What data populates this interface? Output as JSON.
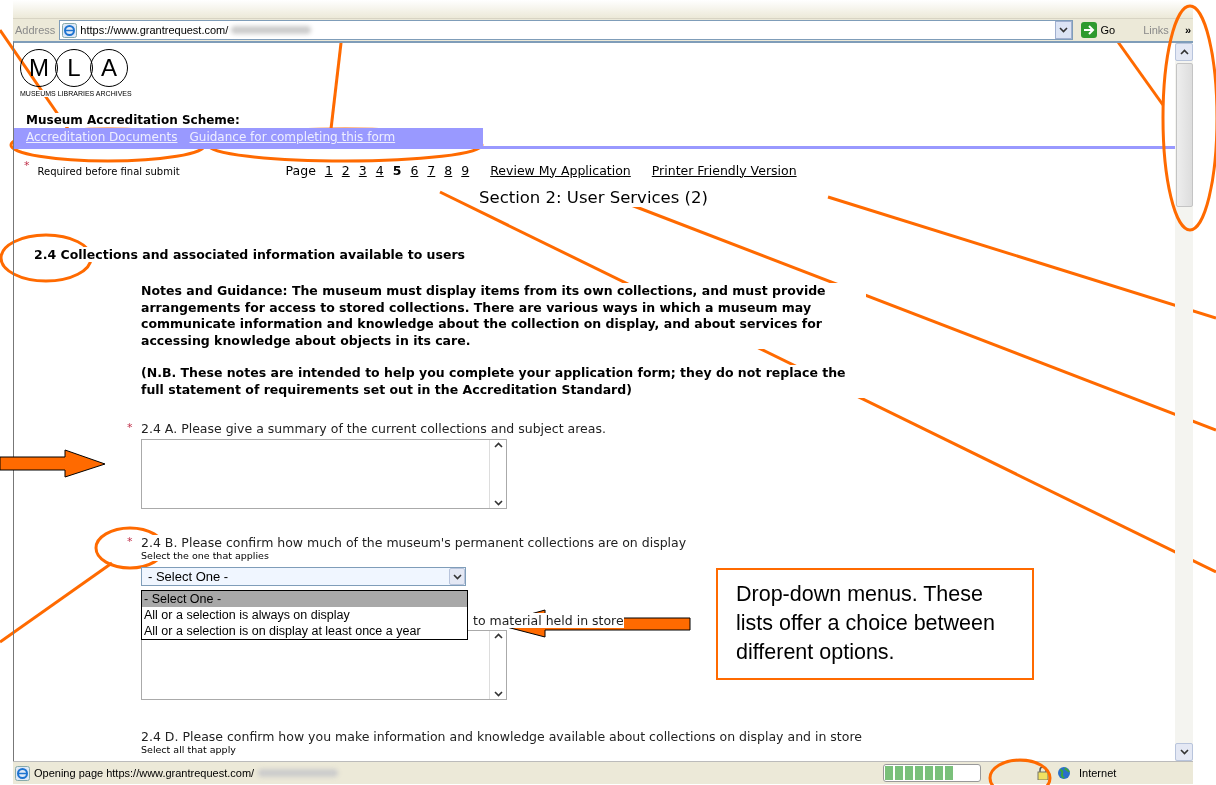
{
  "address_bar": {
    "label": "Address",
    "url": "https://www.grantrequest.com/",
    "go": "Go",
    "links": "Links",
    "more": "»"
  },
  "header": {
    "logo_letters": [
      "M",
      "L",
      "A"
    ],
    "logo_caption": "MUSEUMS LIBRARIES ARCHIVES",
    "scheme_title": "Museum Accreditation Scheme:"
  },
  "nav_links": [
    "Accreditation Documents",
    "Guidance for completing this form"
  ],
  "required_note": {
    "mark": "*",
    "text": "Required before final submit"
  },
  "pagination": {
    "label": "Page",
    "pages": [
      {
        "label": "1",
        "selected": false
      },
      {
        "label": "2",
        "selected": false
      },
      {
        "label": "3",
        "selected": false
      },
      {
        "label": "4",
        "selected": false
      },
      {
        "label": "5",
        "selected": true
      },
      {
        "label": "6",
        "selected": false
      },
      {
        "label": "7",
        "selected": false
      },
      {
        "label": "8",
        "selected": false
      },
      {
        "label": "9",
        "selected": false
      }
    ],
    "links": [
      "Review My Application",
      "Printer Friendly Version"
    ]
  },
  "section_title": "Section 2: User Services (2)",
  "subsection_title": "2.4 Collections and associated information available to users",
  "guidance": [
    "Notes and Guidance: The museum must display items from its own collections, and must provide arrangements for access to stored collections. There are various ways in which a museum may communicate information and knowledge about the collection on display, and about services for accessing knowledge about objects in its care.",
    "(N.B. These notes are intended to help you complete your application form; they do not replace the full statement of requirements set out in the Accreditation Standard)"
  ],
  "questions": [
    {
      "kind": "textarea",
      "required": true,
      "label": "2.4 A. Please give a summary of the current collections and subject areas."
    },
    {
      "kind": "select",
      "required": true,
      "label": "2.4 B. Please confirm how much of the museum's permanent collections are on display",
      "hint": "Select the one that applies",
      "value": "- Select One -",
      "expanded": true,
      "options": [
        {
          "label": "- Select One -",
          "selected": true
        },
        {
          "label": "All or a selection is always on display",
          "selected": false
        },
        {
          "label": "All or a selection is on display at least once a year",
          "selected": false
        }
      ]
    },
    {
      "kind": "textarea",
      "required": false,
      "label": "to material held in store"
    },
    {
      "kind": "checklist",
      "required": false,
      "label": "2.4 D. Please confirm how you make information and knowledge available about collections on display and in store",
      "hint": "Select all that apply"
    }
  ],
  "callout": "Drop-down menus. These lists offer a choice between different options.",
  "status_bar": {
    "text": "Opening page https://www.grantrequest.com/",
    "progress": {
      "level": 0.72
    },
    "zone": "Internet"
  }
}
